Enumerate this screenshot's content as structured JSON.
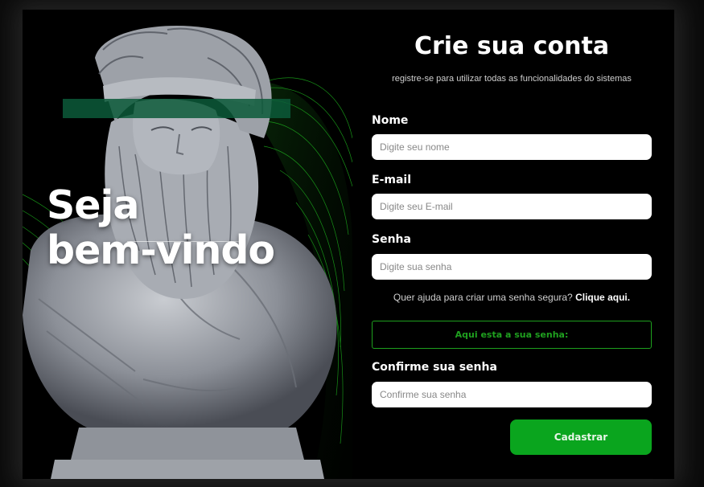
{
  "hero": {
    "line1": "Seja",
    "line2": "bem-vindo"
  },
  "form": {
    "title": "Crie sua conta",
    "subtitle": "registre-se para utilizar todas as funcionalidades do sistemas",
    "name": {
      "label": "Nome",
      "placeholder": "Digite seu nome",
      "value": ""
    },
    "email": {
      "label": "E-mail",
      "placeholder": "Digite seu E-mail",
      "value": ""
    },
    "password": {
      "label": "Senha",
      "placeholder": "Digite sua senha",
      "value": ""
    },
    "help_text": "Quer ajuda para criar uma senha segura?",
    "help_link": "Clique aqui.",
    "generated_password_label": "Aqui esta a sua senha:",
    "confirm": {
      "label": "Confirme sua senha",
      "placeholder": "Confirme sua senha",
      "value": ""
    },
    "submit_label": "Cadastrar"
  },
  "colors": {
    "background": "#000000",
    "accent_green": "#0aa51e",
    "hero_bar": "#0c5a3a"
  },
  "icons": [
    "statue-image",
    "green-mesh-waves"
  ]
}
